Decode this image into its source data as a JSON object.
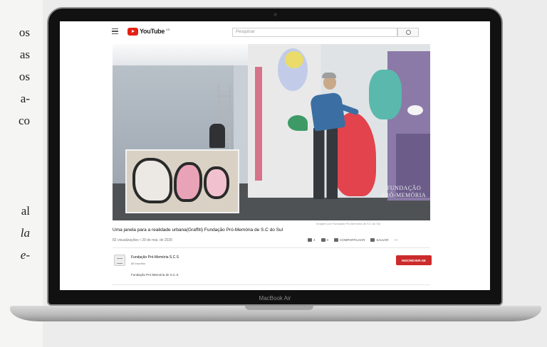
{
  "side_text": {
    "lines": [
      "os",
      "as",
      "os",
      "a-",
      "co",
      "al",
      "la",
      "e-"
    ]
  },
  "laptop": {
    "model_label": "MacBook Air"
  },
  "youtube": {
    "logo_text": "YouTube",
    "logo_country": "BR",
    "search": {
      "placeholder": "Pesquisar"
    },
    "video": {
      "title": "Uma janela para a realidade urbana(Graffiti) Fundação Pró-Memória de S.C do Sul",
      "meta": "82 visualizações • 29 de mai. de 2020",
      "mural_text": [
        "FUNDAÇÃO",
        "PRÓ-MEMÓRIA"
      ],
      "credit": "Imagem por Fundação Pró-Memória de S.C do Sul"
    },
    "actions": [
      {
        "icon": "thumbs-up-icon",
        "label": "4"
      },
      {
        "icon": "thumbs-down-icon",
        "label": "0"
      },
      {
        "icon": "share-icon",
        "label": "COMPARTILHAR"
      },
      {
        "icon": "save-icon",
        "label": "SALVAR"
      }
    ],
    "more_label": "...",
    "channel": {
      "name": "Fundação Pró-Memória S.C.S",
      "subscribers": "85 inscritos",
      "subscribe_label": "INSCREVER-SE"
    },
    "description": "Fundação Pró-Memória de S.C.S"
  },
  "colors": {
    "brand_red": "#e52117",
    "subscribe_red": "#cc2b2b"
  }
}
